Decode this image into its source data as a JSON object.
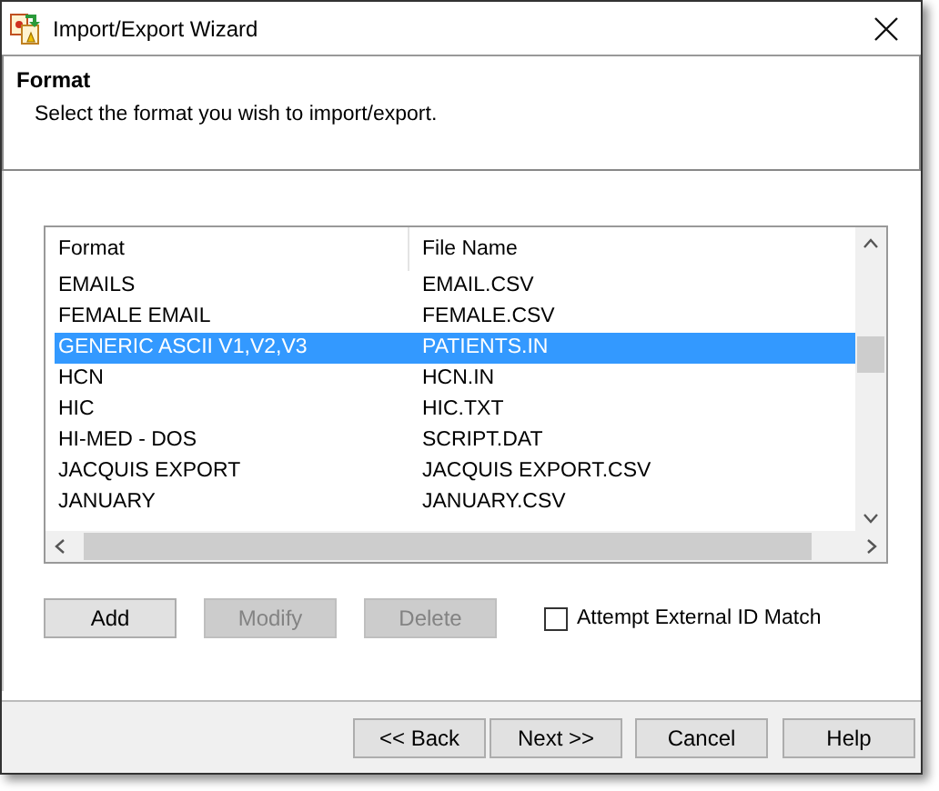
{
  "window": {
    "title": "Import/Export Wizard"
  },
  "header": {
    "title": "Format",
    "description": "Select the format you wish to import/export."
  },
  "table": {
    "columns": [
      "Format",
      "File Name"
    ],
    "rows": [
      {
        "cells": [
          "EMAILS",
          "EMAIL.CSV"
        ],
        "selected": false
      },
      {
        "cells": [
          "FEMALE EMAIL",
          "FEMALE.CSV"
        ],
        "selected": false
      },
      {
        "cells": [
          "GENERIC ASCII V1,V2,V3",
          "PATIENTS.IN"
        ],
        "selected": true
      },
      {
        "cells": [
          "HCN",
          "HCN.IN"
        ],
        "selected": false
      },
      {
        "cells": [
          "HIC",
          "HIC.TXT"
        ],
        "selected": false
      },
      {
        "cells": [
          "HI-MED - DOS",
          "SCRIPT.DAT"
        ],
        "selected": false
      },
      {
        "cells": [
          "JACQUIS EXPORT",
          "JACQUIS EXPORT.CSV"
        ],
        "selected": false
      },
      {
        "cells": [
          "JANUARY",
          "JANUARY.CSV"
        ],
        "selected": false
      }
    ]
  },
  "actions": [
    {
      "label": "Add",
      "disabled": false
    },
    {
      "label": "Modify",
      "disabled": true
    },
    {
      "label": "Delete",
      "disabled": true
    }
  ],
  "checkbox": {
    "label": "Attempt External ID Match",
    "checked": false
  },
  "footer_buttons": [
    "<< Back",
    "Next >>",
    "Cancel",
    "Help"
  ]
}
